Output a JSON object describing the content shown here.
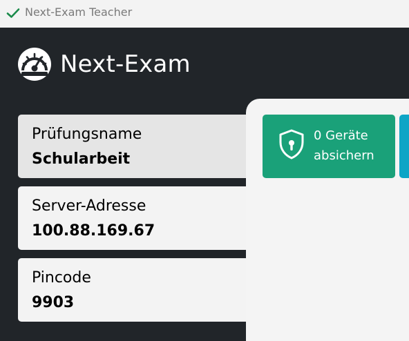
{
  "window": {
    "title": "Next-Exam Teacher",
    "check_icon": "check-icon"
  },
  "brand": {
    "name": "Next-Exam",
    "logo_icon": "speedometer-icon"
  },
  "cards": [
    {
      "label": "Prüfungsname",
      "value": "Schularbeit"
    },
    {
      "label": "Server-Adresse",
      "value": "100.88.169.67"
    },
    {
      "label": "Pincode",
      "value": "9903"
    }
  ],
  "actions": {
    "secure_devices": {
      "line1": "0 Geräte",
      "line2": "absichern",
      "icon": "shield-lock-icon"
    }
  },
  "colors": {
    "sidebar_bg": "#212529",
    "titlebar_bg": "#f3f3f3",
    "check_green": "#1a8a4a",
    "secure_tile": "#1aa179",
    "secondary_tile": "#0ea5c6",
    "content_bg": "#f4f4f4"
  }
}
